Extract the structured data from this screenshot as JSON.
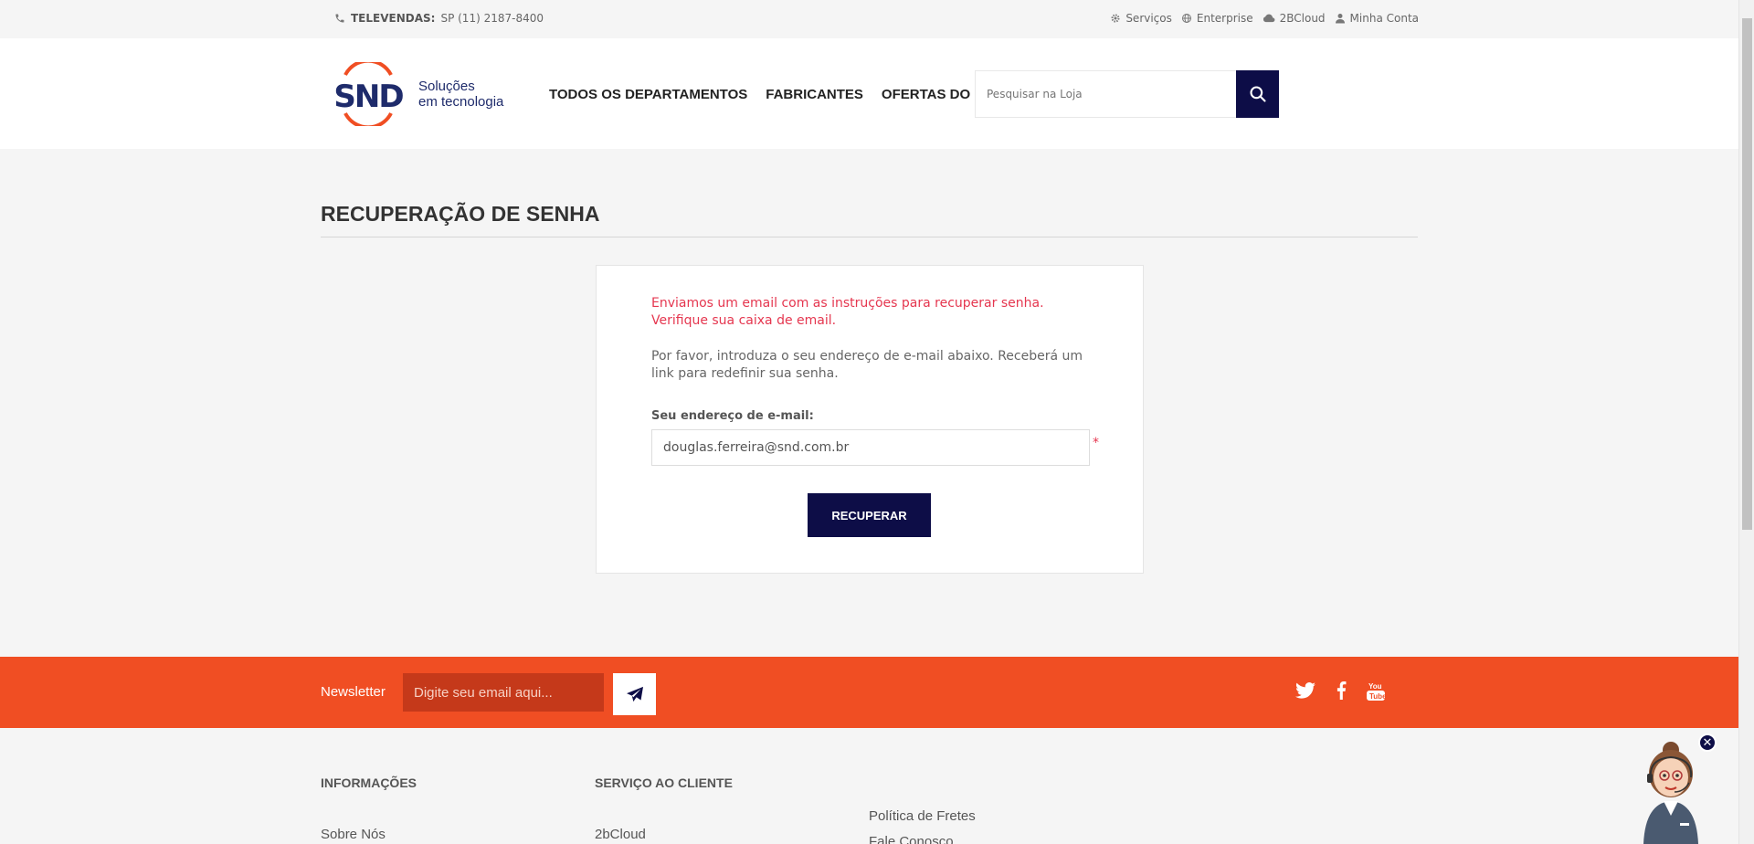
{
  "topbar": {
    "phone_label": "TELEVENDAS:",
    "phone_number": "SP (11)  2187-8400",
    "links": [
      {
        "label": "Serviços",
        "icon": "gear-icon"
      },
      {
        "label": "Enterprise",
        "icon": "globe-icon"
      },
      {
        "label": "2BCloud",
        "icon": "cloud-icon"
      },
      {
        "label": "Minha Conta",
        "icon": "user-icon"
      }
    ]
  },
  "header": {
    "logo_text": "SND",
    "logo_tagline_1": "Soluções",
    "logo_tagline_2": "em tecnologia",
    "nav": [
      "TODOS OS DEPARTAMENTOS",
      "FABRICANTES",
      "OFERTAS DO DIA"
    ],
    "search_placeholder": "Pesquisar na Loja"
  },
  "main": {
    "title": "RECUPERAÇÃO DE SENHA",
    "alert": "Enviamos um email com as instruções para recuperar senha. Verifique sua caixa de email.",
    "intro": "Por favor, introduza o seu endereço de e-mail abaixo. Receberá um link para redefinir sua senha.",
    "email_label": "Seu endereço de e-mail:",
    "email_value": "douglas.ferreira@snd.com.br",
    "required_mark": "*",
    "submit_label": "RECUPERAR"
  },
  "newsletter": {
    "label": "Newsletter",
    "placeholder": "Digite seu email aqui...",
    "social": [
      "twitter-icon",
      "facebook-icon",
      "youtube-icon"
    ]
  },
  "footer": {
    "col1_title": "INFORMAÇÕES",
    "col1_item": "Sobre Nós",
    "col2_title": "SERVIÇO AO CLIENTE",
    "col2_item": "2bCloud",
    "col3_item1": "Política de Fretes",
    "col3_item2": "Fale Conosco"
  },
  "colors": {
    "brand_navy": "#0d0d47",
    "brand_orange": "#f04e23",
    "alert_red": "#e5364f"
  }
}
